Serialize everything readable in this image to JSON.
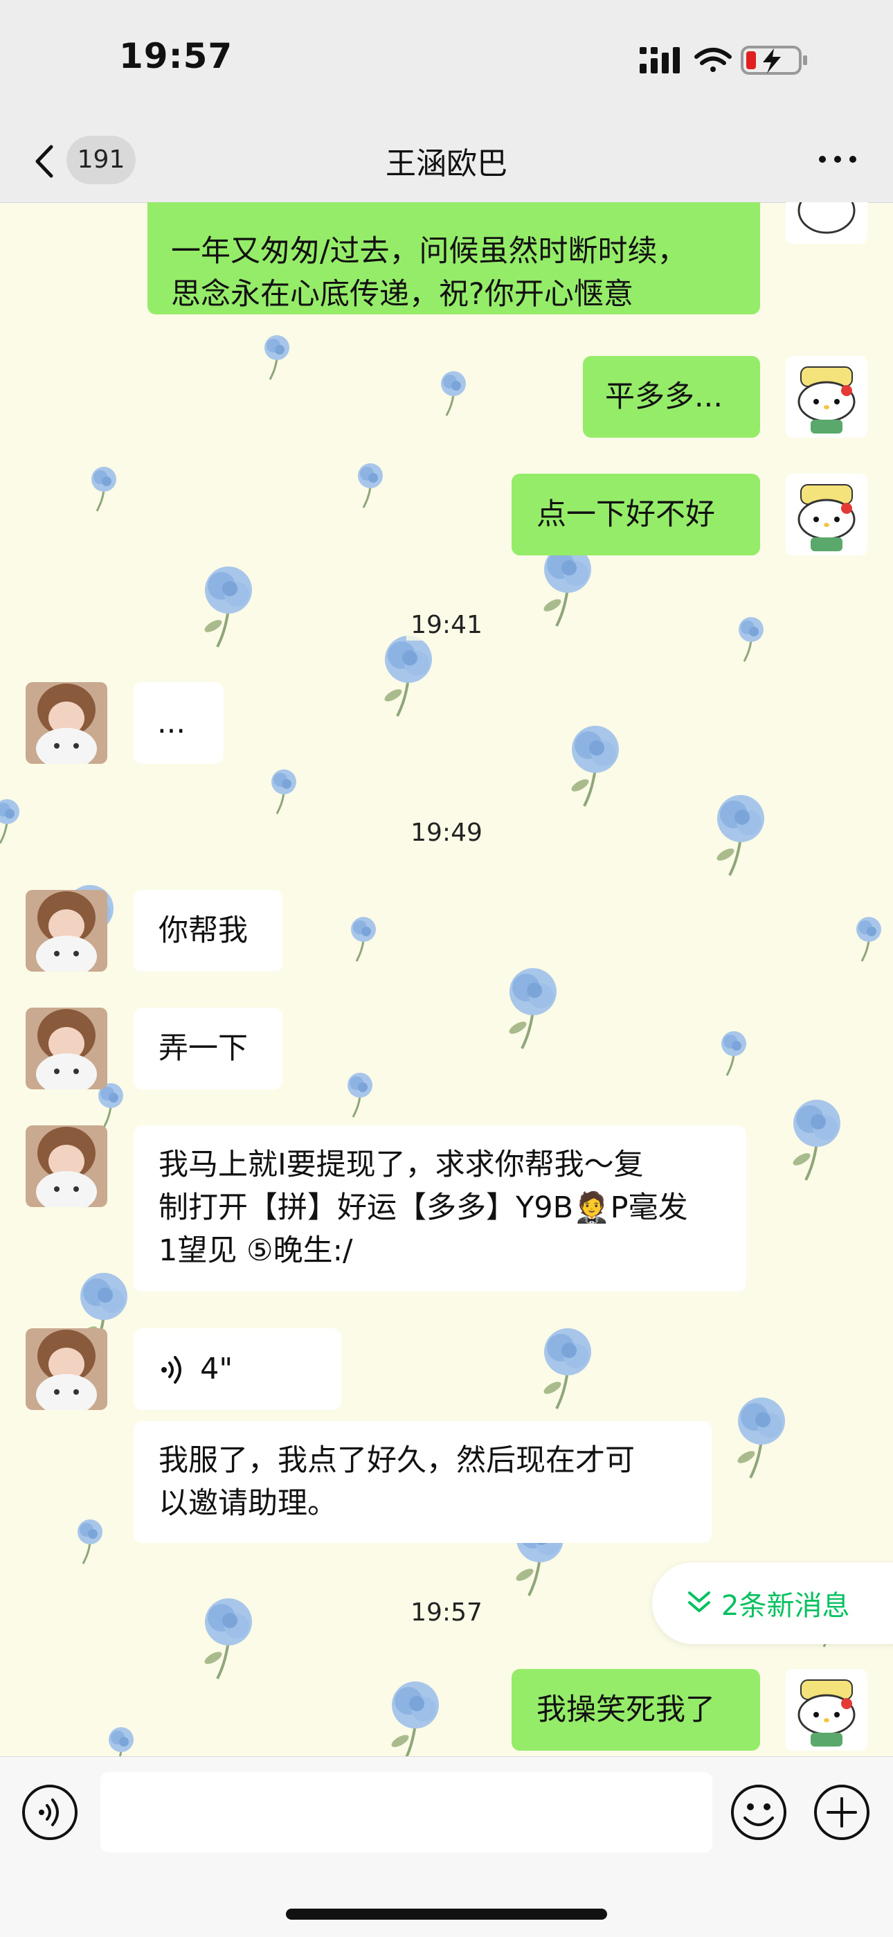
{
  "status_bar": {
    "time": "19:57"
  },
  "nav": {
    "back_count": "191",
    "title": "王涵欧巴",
    "more_icon": "ellipsis-icon"
  },
  "messages": [
    {
      "side": "me",
      "text": "一年又匆匆/过去，问候虽然时断时续，\n思念永在心底传递，祝?你开心惬意"
    },
    {
      "side": "me",
      "text": "平多多..."
    },
    {
      "side": "me",
      "text": "点一下好不好"
    },
    {
      "type": "time",
      "text": "19:41"
    },
    {
      "side": "them",
      "text": "..."
    },
    {
      "type": "time",
      "text": "19:49"
    },
    {
      "side": "them",
      "text": "你帮我"
    },
    {
      "side": "them",
      "text": "弄一下"
    },
    {
      "side": "them",
      "text": "我马上就I要提现了，求求你帮我～复\n制打开【拼】好运【多多】Y9B🤵P毫发\n1望见 ⑤晚生:/"
    },
    {
      "side": "them",
      "type": "voice",
      "text": "4\""
    },
    {
      "side": "them",
      "text": "我服了，我点了好久，然后现在才可\n以邀请助理。"
    },
    {
      "type": "time",
      "text": "19:57"
    },
    {
      "side": "me",
      "text": "我操笑死我了"
    }
  ],
  "new_messages": {
    "label": "2条新消息",
    "icon": "double-chevron-down-icon"
  },
  "input_bar": {
    "voice_icon": "voice-icon",
    "emoji_icon": "emoji-icon",
    "plus_icon": "plus-icon",
    "value": ""
  },
  "colors": {
    "my_bubble": "#95ec69",
    "their_bubble": "#ffffff",
    "accent": "#07c160",
    "wallpaper": "#fbfbe7"
  }
}
